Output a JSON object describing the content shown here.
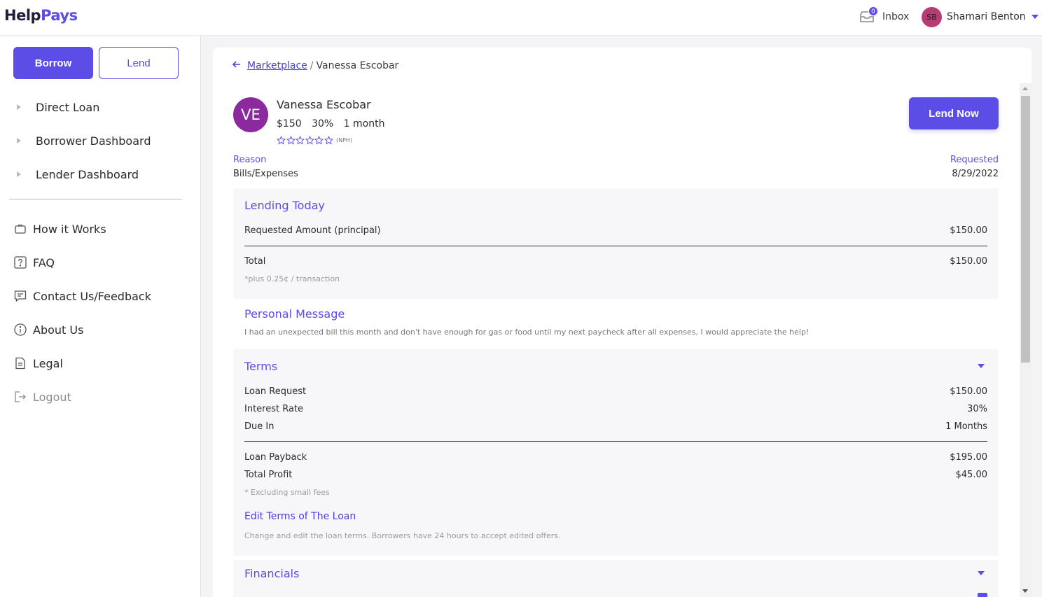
{
  "header": {
    "logo_part1": "Help",
    "logo_part2": "Pays",
    "inbox_count": "0",
    "inbox_label": "Inbox",
    "user_initials": "SB",
    "user_name": "Shamari Benton"
  },
  "sidebar": {
    "borrow_label": "Borrow",
    "lend_label": "Lend",
    "expandable": [
      {
        "label": "Direct Loan"
      },
      {
        "label": "Borrower Dashboard"
      },
      {
        "label": "Lender Dashboard"
      }
    ],
    "links": [
      {
        "label": "How it Works",
        "icon": "briefcase-icon"
      },
      {
        "label": "FAQ",
        "icon": "question-icon"
      },
      {
        "label": "Contact Us/Feedback",
        "icon": "chat-icon"
      },
      {
        "label": "About Us",
        "icon": "info-icon"
      },
      {
        "label": "Legal",
        "icon": "document-icon"
      },
      {
        "label": "Logout",
        "icon": "logout-icon"
      }
    ]
  },
  "breadcrumb": {
    "parent": "Marketplace",
    "separator": "/",
    "current": "Vanessa Escobar"
  },
  "profile": {
    "initials": "VE",
    "name": "Vanessa Escobar",
    "amount": "$150",
    "rate": "30%",
    "duration": "1 month",
    "rating_note": "(NPH)",
    "rating_stars_filled": 0,
    "rating_stars_total": 6,
    "lend_now_label": "Lend Now",
    "reason_label": "Reason",
    "reason_value": "Bills/Expenses",
    "requested_label": "Requested",
    "requested_value": "8/29/2022"
  },
  "lending_today": {
    "title": "Lending Today",
    "principal_label": "Requested Amount (principal)",
    "principal_value": "$150.00",
    "total_label": "Total",
    "total_value": "$150.00",
    "fee_note": "*plus 0.25¢ / transaction"
  },
  "personal_message": {
    "title": "Personal Message",
    "text": "I had an unexpected bill this month and don't have enough for gas or food until my next paycheck after all expenses, I would appreciate the help!"
  },
  "terms": {
    "title": "Terms",
    "loan_request_label": "Loan Request",
    "loan_request_value": "$150.00",
    "interest_label": "Interest Rate",
    "interest_value": "30%",
    "due_label": "Due In",
    "due_value": "1 Months",
    "payback_label": "Loan Payback",
    "payback_value": "$195.00",
    "profit_label": "Total Profit",
    "profit_value": "$45.00",
    "fees_note": "* Excluding small fees",
    "edit_link": "Edit Terms of The Loan",
    "edit_note": "Change and edit the loan terms. Borrowers have 24 hours to accept edited offers."
  },
  "financials": {
    "title": "Financials"
  },
  "colors": {
    "accent": "#5b4de6",
    "avatar_user": "#b83b74",
    "avatar_profile": "#8a2a9e"
  }
}
